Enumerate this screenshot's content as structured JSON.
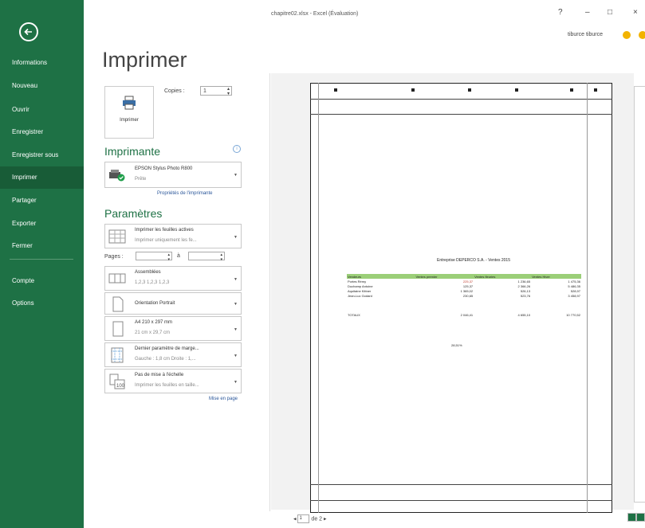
{
  "window": {
    "title": "chapitre02.xlsx - Excel (Évaluation)",
    "help": "?",
    "minimize": "–",
    "maximize": "□",
    "close": "×",
    "user": "tiburce tiburce"
  },
  "colors": {
    "sidebar": "#1e7145",
    "sidebar_active": "#185c37",
    "accent": "#1e7145",
    "link": "#2b579a",
    "table_header": "#9bcf78"
  },
  "sidebar": {
    "items": [
      {
        "label": "Informations"
      },
      {
        "label": "Nouveau"
      },
      {
        "label": "Ouvrir"
      },
      {
        "label": "Enregistrer"
      },
      {
        "label": "Enregistrer sous"
      },
      {
        "label": "Imprimer",
        "active": true
      },
      {
        "label": "Partager"
      },
      {
        "label": "Exporter"
      },
      {
        "label": "Fermer"
      },
      {
        "label": "Compte"
      },
      {
        "label": "Options"
      }
    ]
  },
  "print": {
    "heading": "Imprimer",
    "button_label": "Imprimer",
    "copies_label": "Copies :",
    "copies_value": "1",
    "printer_heading": "Imprimante",
    "printer_name": "EPSON Stylus Photo R800",
    "printer_status": "Prête",
    "printer_props": "Propriétés de l'imprimante",
    "settings_heading": "Paramètres",
    "active_sheets": "Imprimer les feuilles actives",
    "active_sheets_sub": "Imprimer uniquement les fe...",
    "pages_label": "Pages :",
    "pages_to": "à",
    "collate": "Assemblées",
    "collate_sub": "1,2,3   1,2,3   1,2,3",
    "orientation": "Orientation Portrait",
    "paper": "A4 210 x 297 mm",
    "paper_sub": "21 cm x 29,7 cm",
    "margins": "Dernier paramètre de marge...",
    "margins_sub": "Gauche : 1,8 cm   Droite : 1,...",
    "scaling": "Pas de mise à l'échelle",
    "scaling_sub": "Imprimer les feuilles en taille...",
    "page_setup": "Mise en page"
  },
  "preview": {
    "doc_title": "Entreprise DEPERCO S.A. - Ventes 2015",
    "columns": [
      "Vendeurs",
      "Ventes premier",
      "Ventes fleuries",
      "Ventes Hiver"
    ],
    "rows": [
      [
        "Portes Rémy",
        "225,37",
        "1 236,65",
        "1 475,36"
      ],
      [
        "Duchamp Antoine",
        "125,37",
        "2 366,26",
        "5 486,35"
      ],
      [
        "Aquitaine Kittner",
        "1 365,02",
        "526,13",
        "528,97"
      ],
      [
        "Jean-Luc Godard",
        "230,65",
        "523,76",
        "3 458,97"
      ]
    ],
    "total_row": [
      "TOTAUX",
      "2 046,41",
      "4 655,10",
      "10 770,52"
    ],
    "percent": "28,51%",
    "page_current": "1",
    "page_of": "de 2"
  }
}
